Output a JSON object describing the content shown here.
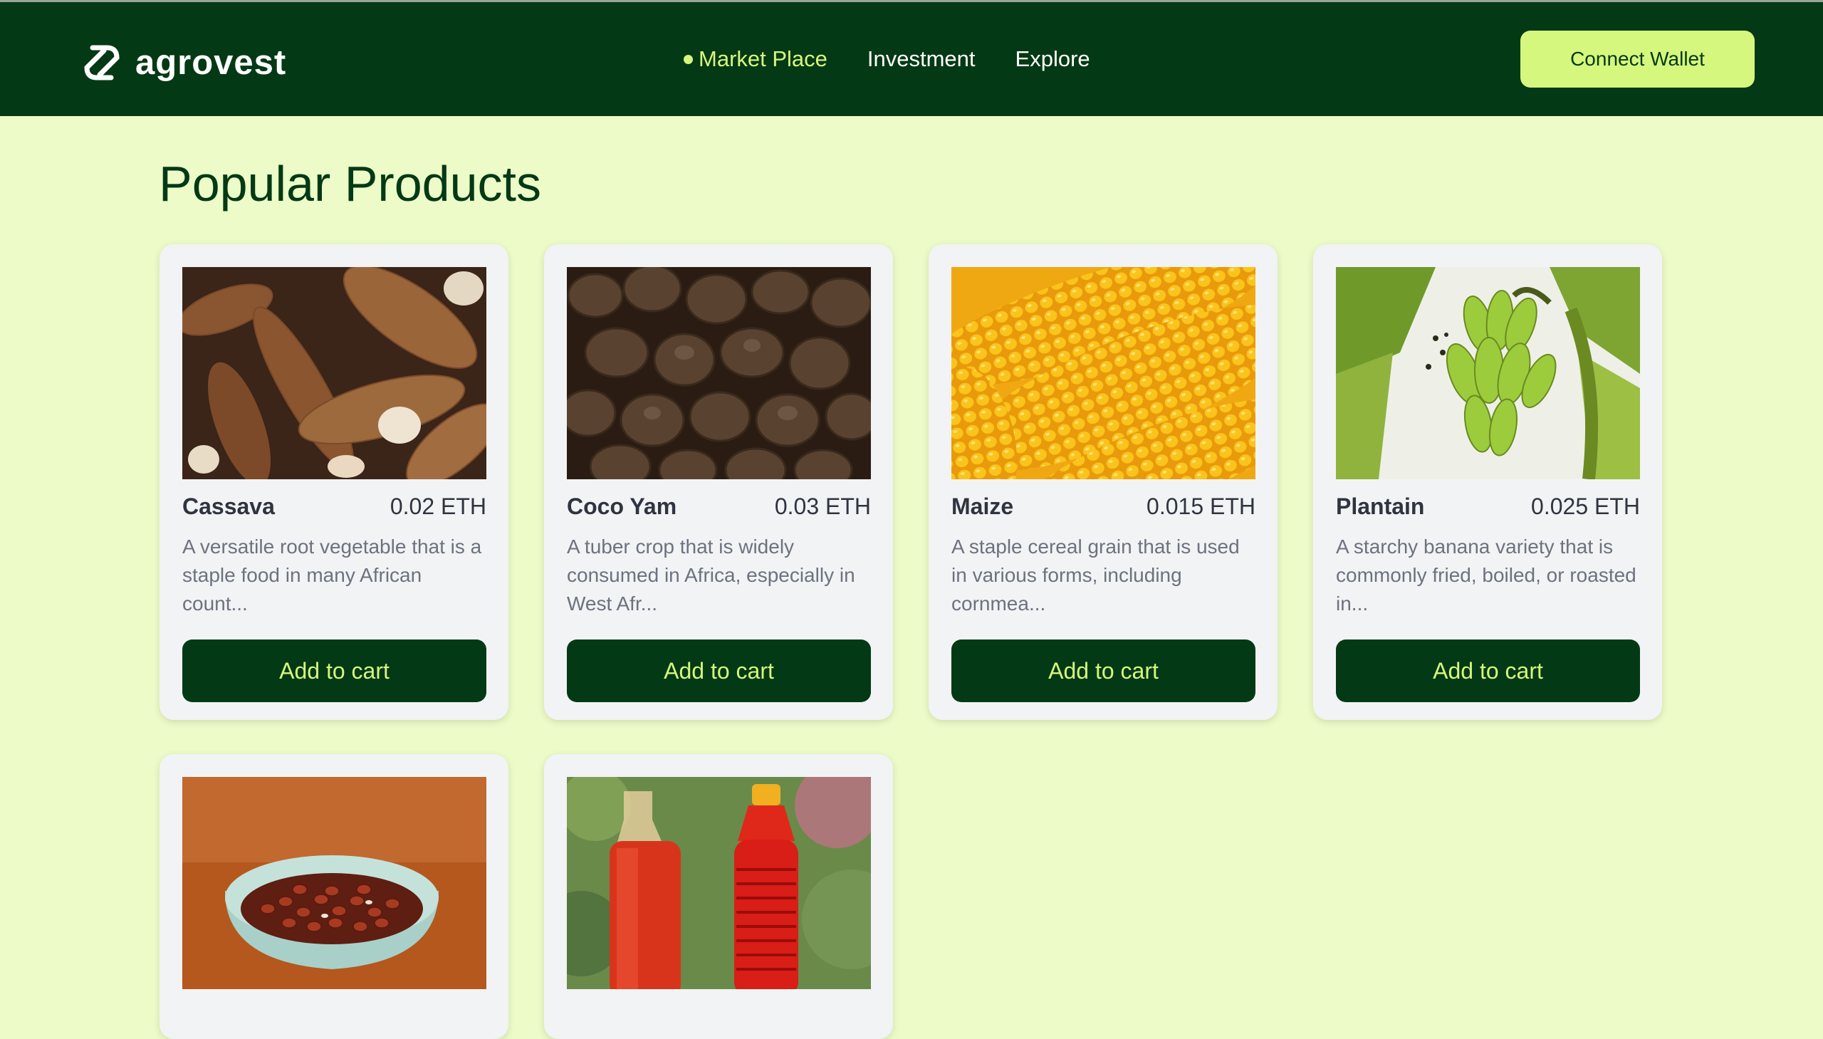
{
  "brand": {
    "name": "agrovest"
  },
  "nav": {
    "links": [
      {
        "label": "Market Place",
        "active": true
      },
      {
        "label": "Investment",
        "active": false
      },
      {
        "label": "Explore",
        "active": false
      }
    ],
    "connect_label": "Connect Wallet"
  },
  "main": {
    "title": "Popular Products",
    "products": [
      {
        "name": "Cassava",
        "price": "0.02 ETH",
        "description": "A versatile root vegetable that is a staple food in many African count...",
        "button": "Add to cart",
        "image": "cassava-photo"
      },
      {
        "name": "Coco Yam",
        "price": "0.03 ETH",
        "description": "A tuber crop that is widely consumed in Africa, especially in West Afr...",
        "button": "Add to cart",
        "image": "cocoyam-photo"
      },
      {
        "name": "Maize",
        "price": "0.015 ETH",
        "description": "A staple cereal grain that is used in various forms, including cornmea...",
        "button": "Add to cart",
        "image": "maize-photo"
      },
      {
        "name": "Plantain",
        "price": "0.025 ETH",
        "description": "A starchy banana variety that is commonly fried, boiled, or roasted in...",
        "button": "Add to cart",
        "image": "plantain-photo"
      },
      {
        "image": "groundnut-photo"
      },
      {
        "image": "palm-oil-photo"
      }
    ]
  },
  "colors": {
    "nav_bg": "#043915",
    "accent": "#d6f77d",
    "page_bg": "#ecfbc7",
    "card_bg": "#f2f3f4"
  }
}
